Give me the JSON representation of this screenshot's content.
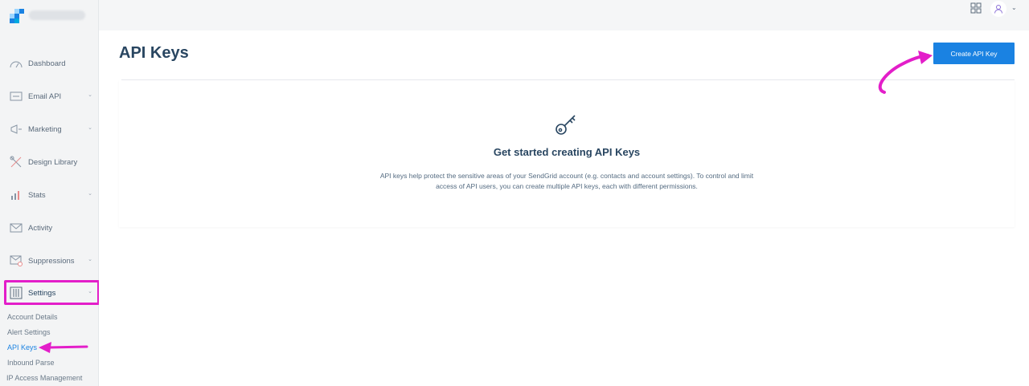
{
  "sidebar": {
    "items": [
      {
        "label": "Dashboard",
        "icon": "dashboard-gauge-icon",
        "has_chevron": false
      },
      {
        "label": "Email API",
        "icon": "email-api-icon",
        "has_chevron": true
      },
      {
        "label": "Marketing",
        "icon": "megaphone-icon",
        "has_chevron": true
      },
      {
        "label": "Design Library",
        "icon": "design-tools-icon",
        "has_chevron": false
      },
      {
        "label": "Stats",
        "icon": "stats-chart-icon",
        "has_chevron": true
      },
      {
        "label": "Activity",
        "icon": "envelope-activity-icon",
        "has_chevron": false
      },
      {
        "label": "Suppressions",
        "icon": "suppression-envelope-icon",
        "has_chevron": true
      },
      {
        "label": "Settings",
        "icon": "settings-panel-icon",
        "has_chevron": true
      }
    ],
    "settings_sub": [
      {
        "label": "Account Details",
        "active": false
      },
      {
        "label": "Alert Settings",
        "active": false
      },
      {
        "label": "API Keys",
        "active": true
      },
      {
        "label": "Inbound Parse",
        "active": false
      },
      {
        "label": "IP Access Management",
        "active": false
      }
    ]
  },
  "header": {
    "page_title": "API Keys",
    "create_button": "Create API Key"
  },
  "empty_state": {
    "title": "Get started creating API Keys",
    "description": "API keys help protect the sensitive areas of your SendGrid account (e.g. contacts and account settings). To control and limit access of API users, you can create multiple API keys, each with different permissions."
  },
  "colors": {
    "accent": "#1a82e2",
    "annotation": "#e31ec9",
    "heading": "#294661"
  }
}
